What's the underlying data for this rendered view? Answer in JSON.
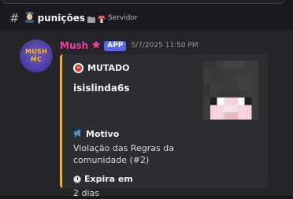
{
  "channel": {
    "hash_symbol": "#",
    "icon": "police-officer-emoji",
    "name": "punições",
    "separator_icon": "folder-emoji",
    "server_icon": "mushroom-emoji",
    "server_name": "Servidor"
  },
  "message": {
    "avatar": {
      "icon": "mush-logo",
      "line1": "MUSH",
      "line2": "MC"
    },
    "username": "Mush",
    "user_color": "#e9419d",
    "badge_icon": "star-icon",
    "app_badge": "APP",
    "timestamp": "5/7/2025 11:50 PM",
    "embed": {
      "accent_color": "#f0b232",
      "author": {
        "icon": "mute-badge-icon",
        "name": "MUTADO"
      },
      "title": "isislinda6s",
      "fields": [
        {
          "icon": "megaphone-icon",
          "name": "Motivo",
          "value": "Violação das Regras da comunidade (#2)"
        },
        {
          "icon": "stopwatch-icon",
          "name": "Expira em",
          "value": "2 dias"
        }
      ],
      "thumbnail": "minecraft-skin-head"
    }
  }
}
